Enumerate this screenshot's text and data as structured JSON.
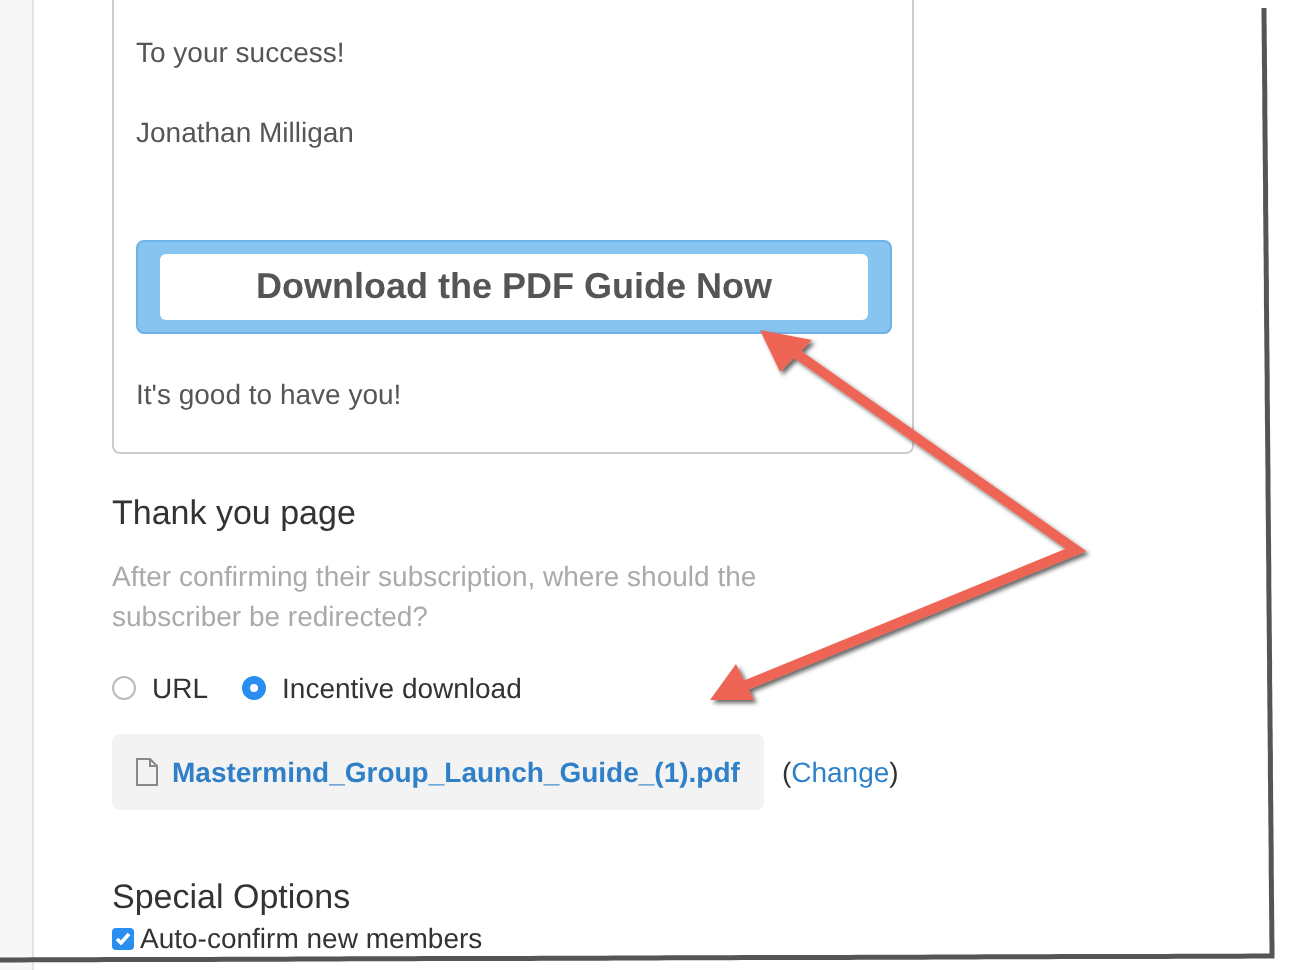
{
  "email_card": {
    "lines": [
      "To your success!",
      "Jonathan Milligan"
    ],
    "button": "Download the PDF Guide Now",
    "closing": "It's good to have you!"
  },
  "thank_you_page": {
    "heading": "Thank you page",
    "description": "After confirming their subscription, where should the subscriber be redirected?",
    "options": [
      {
        "label": "URL",
        "selected": false
      },
      {
        "label": "Incentive download",
        "selected": true
      }
    ],
    "file": {
      "name": "Mastermind_Group_Launch_Guide_(1).pdf",
      "open_paren": "(",
      "change_link": "Change",
      "close_paren": ")"
    }
  },
  "special_options": {
    "heading": "Special Options",
    "checkboxes": [
      {
        "label": "Auto-confirm new members",
        "checked": true
      }
    ]
  }
}
